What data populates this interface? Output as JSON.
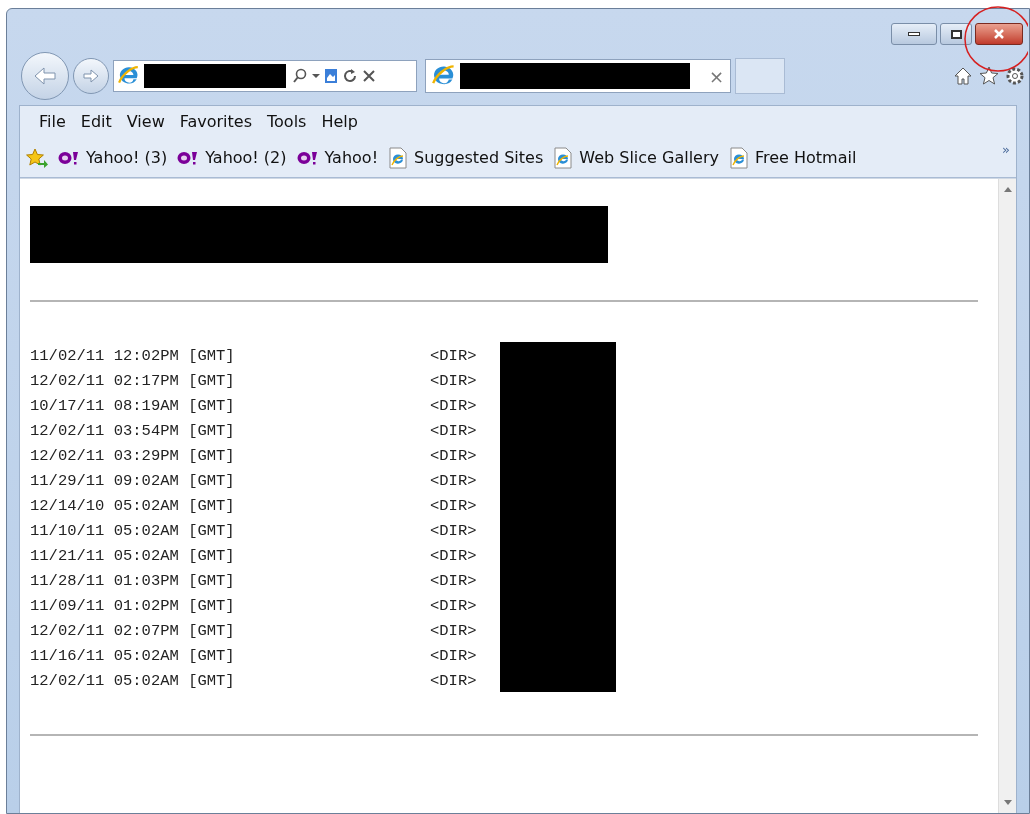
{
  "address_bar": {
    "kind": "redacted"
  },
  "tab": {
    "selected": true,
    "close": "×"
  },
  "menu": [
    "File",
    "Edit",
    "View",
    "Favorites",
    "Tools",
    "Help"
  ],
  "favorites_bar": {
    "items": [
      {
        "kind": "yahoo",
        "label": "Yahoo! (3)"
      },
      {
        "kind": "yahoo",
        "label": "Yahoo! (2)"
      },
      {
        "kind": "yahoo",
        "label": "Yahoo!"
      },
      {
        "kind": "ie",
        "label": "Suggested Sites"
      },
      {
        "kind": "ie",
        "label": "Web Slice Gallery"
      },
      {
        "kind": "ie",
        "label": "Free Hotmail"
      }
    ],
    "overflow": "»"
  },
  "listing": {
    "rows": [
      {
        "date": "11/02/11 12:02PM [GMT]",
        "type": "<DIR>"
      },
      {
        "date": "12/02/11 02:17PM [GMT]",
        "type": "<DIR>"
      },
      {
        "date": "10/17/11 08:19AM [GMT]",
        "type": "<DIR>"
      },
      {
        "date": "12/02/11 03:54PM [GMT]",
        "type": "<DIR>"
      },
      {
        "date": "12/02/11 03:29PM [GMT]",
        "type": "<DIR>"
      },
      {
        "date": "11/29/11 09:02AM [GMT]",
        "type": "<DIR>"
      },
      {
        "date": "12/14/10 05:02AM [GMT]",
        "type": "<DIR>"
      },
      {
        "date": "11/10/11 05:02AM [GMT]",
        "type": "<DIR>"
      },
      {
        "date": "11/21/11 05:02AM [GMT]",
        "type": "<DIR>"
      },
      {
        "date": "11/28/11 01:03PM [GMT]",
        "type": "<DIR>"
      },
      {
        "date": "11/09/11 01:02PM [GMT]",
        "type": "<DIR>"
      },
      {
        "date": "12/02/11 02:07PM [GMT]",
        "type": "<DIR>"
      },
      {
        "date": "11/16/11 05:02AM [GMT]",
        "type": "<DIR>"
      },
      {
        "date": "12/02/11 05:02AM [GMT]",
        "type": "<DIR>"
      }
    ]
  }
}
